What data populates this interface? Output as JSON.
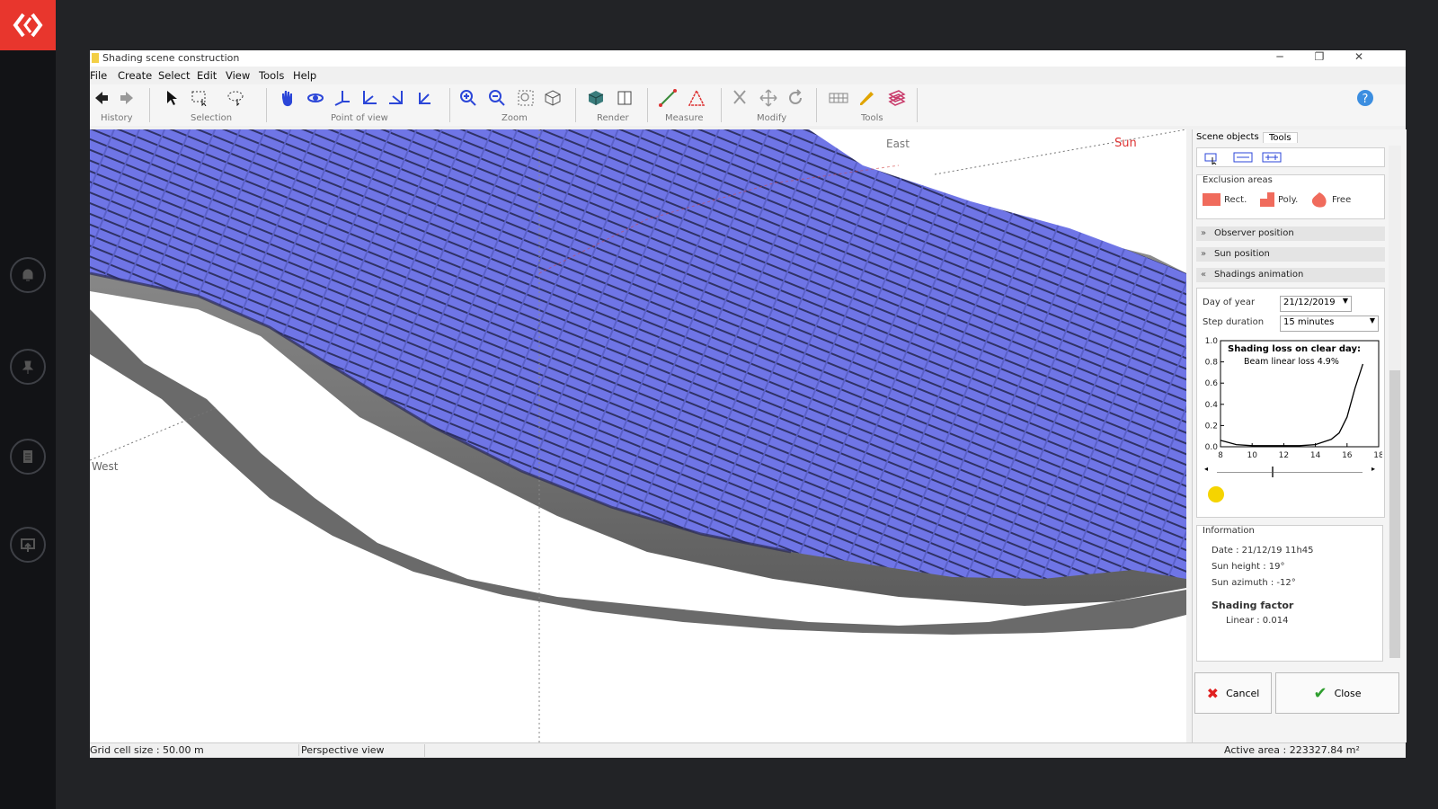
{
  "window": {
    "title": "Shading scene construction",
    "controls": [
      "─",
      "❐",
      "✕"
    ]
  },
  "menu": [
    "File",
    "Create",
    "Select",
    "Edit",
    "View",
    "Tools",
    "Help"
  ],
  "toolbar_groups": [
    "History",
    "Selection",
    "Point of view",
    "Zoom",
    "Render",
    "Measure",
    "Modify",
    "Tools"
  ],
  "viewport": {
    "east": "East",
    "west": "West",
    "sun": "Sun"
  },
  "panel": {
    "tabs": [
      "Scene objects",
      "Tools"
    ],
    "exclusion": {
      "title": "Exclusion areas",
      "rect": "Rect.",
      "poly": "Poly.",
      "free": "Free"
    },
    "sections": [
      "Observer position",
      "Sun position",
      "Shadings animation"
    ],
    "day_label": "Day of year",
    "day_value": "21/12/2019",
    "step_label": "Step duration",
    "step_value": "15 minutes",
    "info": {
      "title": "Information",
      "date": "Date : 21/12/19 11h45",
      "sun_height": "Sun height : 19°",
      "sun_azimuth": "Sun azimuth : -12°",
      "shading_title": "Shading factor",
      "linear": "Linear : 0.014"
    },
    "cancel": "Cancel",
    "close": "Close"
  },
  "chart_data": {
    "type": "line",
    "title": "Shading loss on clear day:",
    "subtitle": "Beam linear loss 4.9%",
    "x": [
      8,
      9,
      10,
      11,
      12,
      13,
      14,
      15,
      15.5,
      16,
      16.5,
      17
    ],
    "values": [
      0.06,
      0.02,
      0.01,
      0.01,
      0.01,
      0.01,
      0.02,
      0.07,
      0.13,
      0.28,
      0.55,
      0.78
    ],
    "xlim": [
      8,
      18
    ],
    "ylim": [
      0,
      1.0
    ],
    "xticks": [
      "8",
      "10",
      "12",
      "14",
      "16",
      "18"
    ],
    "yticks": [
      "0.0",
      "0.2",
      "0.4",
      "0.6",
      "0.8",
      "1.0"
    ],
    "slider_value": 11.75
  },
  "statusbar": {
    "grid": "Grid cell size : 50.00 m",
    "view": "Perspective view",
    "area": "Active area : 223327.84 m²"
  },
  "colors": {
    "brand": "#e8362d",
    "panels": "#6f75e6",
    "terrain": "#7a7a7a",
    "sun": "#f5d400"
  }
}
